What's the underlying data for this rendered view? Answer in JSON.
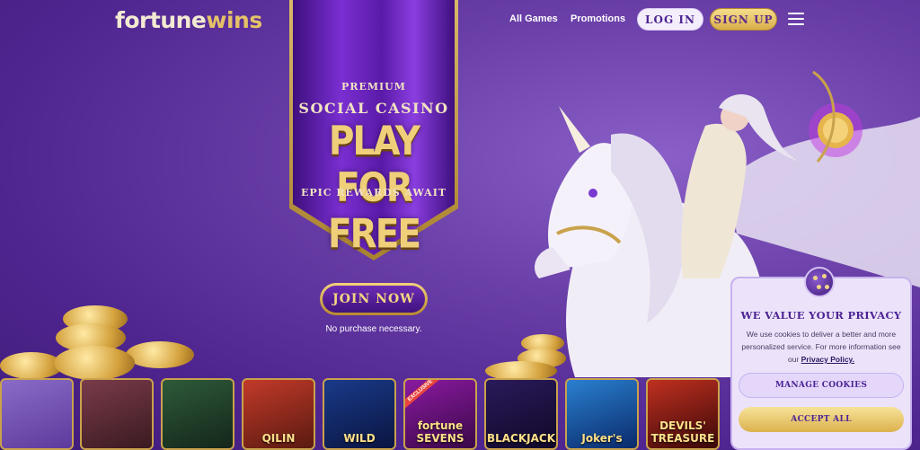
{
  "header": {
    "logo_part1": "fortune",
    "logo_part2": "wins",
    "nav_all_games": "All Games",
    "nav_promotions": "Promotions",
    "login_label": "LOG IN",
    "signup_label": "SIGN UP"
  },
  "banner": {
    "premium": "PREMIUM",
    "social_casino": "SOCIAL CASINO",
    "play_for_free": "PLAY FOR FREE",
    "epic_rewards": "EPIC REWARDS AWAIT"
  },
  "cta": {
    "join_label": "JOIN NOW",
    "disclaimer": "No purchase necessary."
  },
  "games": [
    {
      "title": "",
      "colors": [
        "#8a6cc7",
        "#5d3a9c"
      ]
    },
    {
      "title": "",
      "colors": [
        "#7a3b4a",
        "#3a1a20"
      ]
    },
    {
      "title": "",
      "colors": [
        "#2e5a3a",
        "#14261a"
      ]
    },
    {
      "title": "QILIN",
      "colors": [
        "#c23a2a",
        "#5a1a10"
      ]
    },
    {
      "title": "WILD",
      "colors": [
        "#1a3a8a",
        "#0a1540"
      ]
    },
    {
      "title": "fortune SEVENS",
      "badge": "EXCLUSIVE",
      "colors": [
        "#8a1aa0",
        "#3a0848"
      ]
    },
    {
      "title": "BLACKJACK",
      "colors": [
        "#2a1a5a",
        "#100828"
      ]
    },
    {
      "title": "Joker's",
      "colors": [
        "#2a80d0",
        "#0a2a6a"
      ]
    },
    {
      "title": "DEVILS' TREASURE",
      "colors": [
        "#c03020",
        "#3a0808"
      ]
    }
  ],
  "privacy": {
    "title": "WE VALUE YOUR PRIVACY",
    "body": "We use cookies to deliver a better and more personalized service. For more information see our",
    "link": "Privacy Policy.",
    "manage_label": "MANAGE COOKIES",
    "accept_label": "ACCEPT ALL"
  }
}
